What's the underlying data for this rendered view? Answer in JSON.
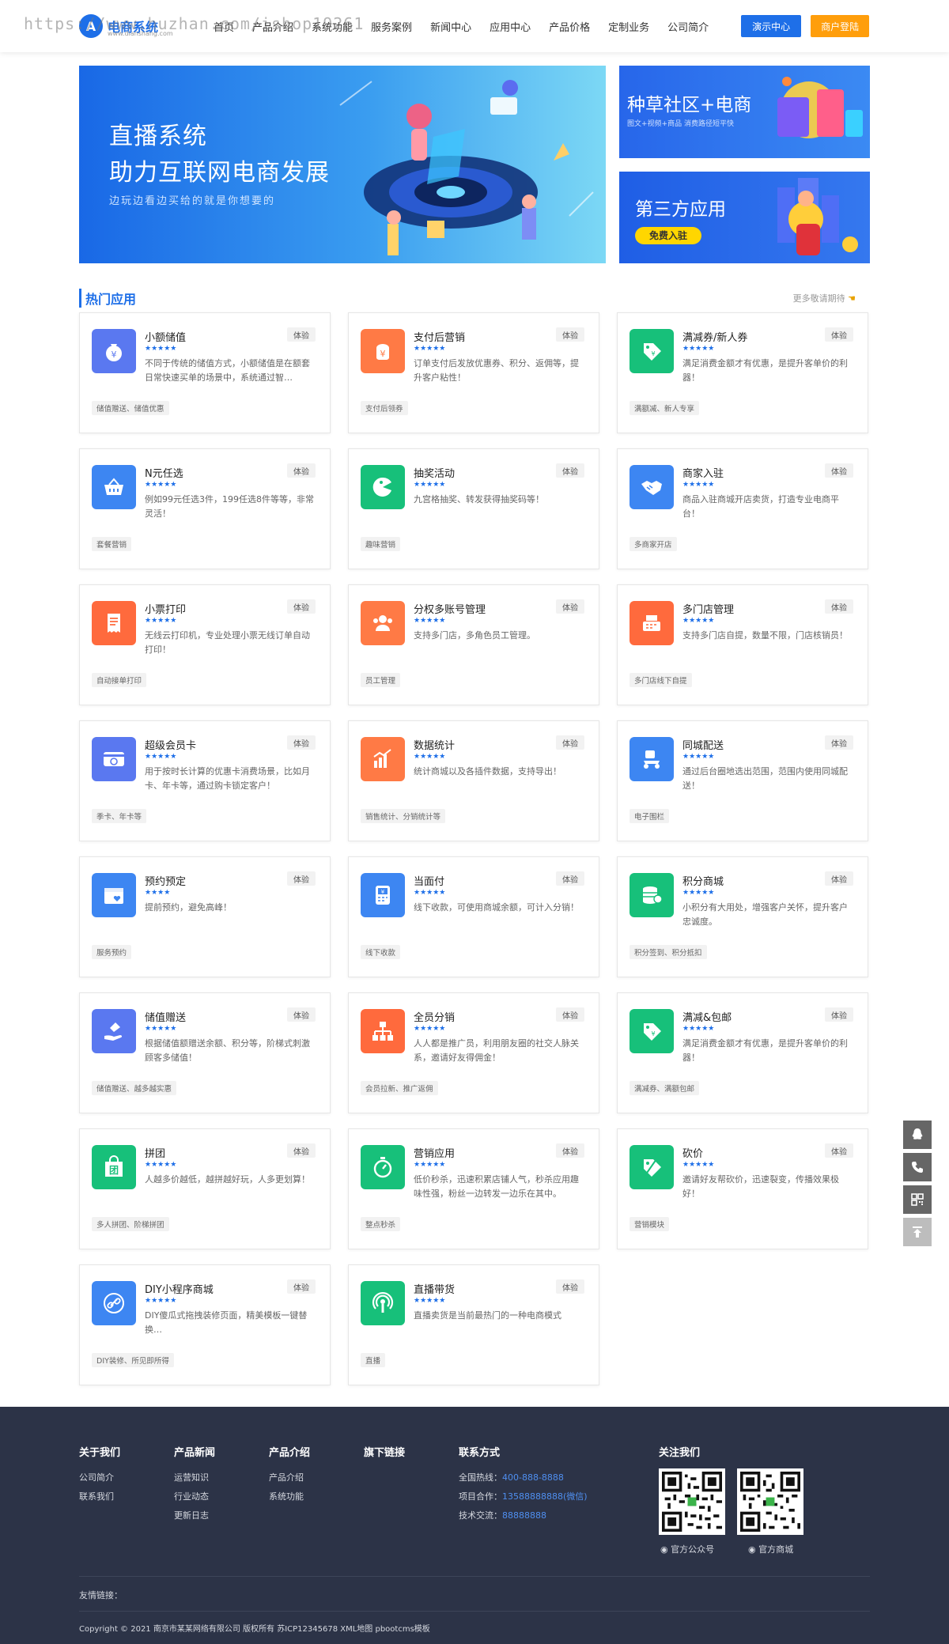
{
  "header": {
    "logo_text": "电商系统",
    "logo_sub": "www.dianshang.com",
    "watermark": "https://www.huzhan.com/ishop19261",
    "nav": [
      "首页",
      "产品介绍",
      "系统功能",
      "服务案例",
      "新闻中心",
      "应用中心",
      "产品价格",
      "定制业务",
      "公司简介"
    ],
    "demo_button": "演示中心",
    "login_button": "商户登陆"
  },
  "banners": {
    "main_line1": "直播系统",
    "main_line2": "助力互联网电商发展",
    "main_line3": "边玩边看边买给的就是你想要的",
    "side1_title": "种草社区+电商",
    "side1_sub": "图文+视频+商品 消费路径短平快",
    "side2_title": "第三方应用",
    "side2_button": "免费入驻"
  },
  "section": {
    "title": "热门应用",
    "more": "更多敬请期待"
  },
  "try_label": "体验",
  "apps": [
    {
      "title": "小额储值",
      "stars": "★★★★★",
      "desc": "不同于传统的储值方式，小额储值是在额套日常快速买单的场景中，系统通过智…",
      "tag": "储值赠送、储值优惠",
      "color": "#5a78f0",
      "icon": "money-bag-icon"
    },
    {
      "title": "支付后营销",
      "stars": "★★★★★",
      "desc": "订单支付后发放优惠券、积分、返佣等，提升客户粘性！",
      "tag": "支付后领券",
      "color": "#ff7a45",
      "icon": "yen-bag-icon"
    },
    {
      "title": "满减券/新人券",
      "stars": "★★★★★",
      "desc": "满足消费金额才有优惠，是提升客单价的利器！",
      "tag": "满额减、新人专享",
      "color": "#17c07a",
      "icon": "coupon-tag-icon"
    },
    {
      "title": "N元任选",
      "stars": "★★★★★",
      "desc": "例如99元任选3件，199任选8件等等，非常灵活！",
      "tag": "套餐营销",
      "color": "#3d86f2",
      "icon": "basket-icon"
    },
    {
      "title": "抽奖活动",
      "stars": "★★★★★",
      "desc": "九宫格抽奖、转发获得抽奖码等！",
      "tag": "趣味营销",
      "color": "#17c07a",
      "icon": "pacman-icon"
    },
    {
      "title": "商家入驻",
      "stars": "★★★★★",
      "desc": "商品入驻商城开店卖货，打造专业电商平台！",
      "tag": "多商家开店",
      "color": "#3d86f2",
      "icon": "handshake-icon"
    },
    {
      "title": "小票打印",
      "stars": "★★★★★",
      "desc": "无线云打印机，专业处理小票无线订单自动打印！",
      "tag": "自动接单打印",
      "color": "#ff6a3d",
      "icon": "receipt-icon"
    },
    {
      "title": "分权多账号管理",
      "stars": "★★★★★",
      "desc": "支持多门店，多角色员工管理。",
      "tag": "员工管理",
      "color": "#ff7a45",
      "icon": "users-icon"
    },
    {
      "title": "多门店管理",
      "stars": "★★★★★",
      "desc": "支持多门店自提，数量不限，门店核销员！",
      "tag": "多门店线下自提",
      "color": "#ff6a3d",
      "icon": "cash-register-icon"
    },
    {
      "title": "超级会员卡",
      "stars": "★★★★★",
      "desc": "用于按时长计算的优惠卡消费场景，比如月卡、年卡等，通过购卡锁定客户！",
      "tag": "季卡、年卡等",
      "color": "#5a78f0",
      "icon": "member-card-icon"
    },
    {
      "title": "数据统计",
      "stars": "★★★★★",
      "desc": "统计商城以及各插件数据，支持导出！",
      "tag": "销售统计、分销统计等",
      "color": "#ff7a45",
      "icon": "bar-chart-icon"
    },
    {
      "title": "同城配送",
      "stars": "★★★★★",
      "desc": "通过后台圈地选出范围，范围内使用同城配送！",
      "tag": "电子围栏",
      "color": "#3d86f2",
      "icon": "scooter-icon"
    },
    {
      "title": "预约预定",
      "stars": "★★★★",
      "desc": "提前预约，避免高峰！",
      "tag": "服务预约",
      "color": "#3d86f2",
      "icon": "calendar-heart-icon"
    },
    {
      "title": "当面付",
      "stars": "★★★★★",
      "desc": "线下收款，可使用商城余额，可计入分销！",
      "tag": "线下收款",
      "color": "#3d86f2",
      "icon": "payment-terminal-icon"
    },
    {
      "title": "积分商城",
      "stars": "★★★★★",
      "desc": "小积分有大用处，增强客户关怀，提升客户忠诚度。",
      "tag": "积分签到、积分抵扣",
      "color": "#17c07a",
      "icon": "coins-stack-icon"
    },
    {
      "title": "储值赠送",
      "stars": "★★★★★",
      "desc": "根据储值额赠送余额、积分等，阶梯式刺激顾客多储值！",
      "tag": "储值赠送、越多越实惠",
      "color": "#5a78f0",
      "icon": "hand-gift-icon"
    },
    {
      "title": "全员分销",
      "stars": "★★★★★",
      "desc": "人人都是推广员，利用朋友圈的社交人脉关系，邀请好友得佣金！",
      "tag": "会员拉新、推广返佣",
      "color": "#ff6a3d",
      "icon": "hierarchy-icon"
    },
    {
      "title": "满减&包邮",
      "stars": "★★★★★",
      "desc": "满足消费金额才有优惠，是提升客单价的利器！",
      "tag": "满减券、满额包邮",
      "color": "#17c07a",
      "icon": "coupon-tag-icon"
    },
    {
      "title": "拼团",
      "stars": "★★★★★",
      "desc": "人越多价越低，越拼越好玩，人多更划算！",
      "tag": "多人拼团、阶梯拼团",
      "color": "#17c07a",
      "icon": "shopping-bag-icon"
    },
    {
      "title": "营销应用",
      "stars": "★★★★★",
      "desc": "低价秒杀，迅速积累店铺人气，秒杀应用趣味性强，粉丝一边转发一边乐在其中。",
      "tag": "整点秒杀",
      "color": "#17c07a",
      "icon": "stopwatch-icon"
    },
    {
      "title": "砍价",
      "stars": "★★★★★",
      "desc": "邀请好友帮砍价，迅速裂变，传播效果极好！",
      "tag": "营销模块",
      "color": "#17c07a",
      "icon": "price-cut-icon"
    },
    {
      "title": "DIY小程序商城",
      "stars": "★★★★★",
      "desc": "DIY傻瓜式拖拽装修页面，精美模板一键替换…",
      "tag": "DIY装修、所见即所得",
      "color": "#3d86f2",
      "icon": "link-icon"
    },
    {
      "title": "直播带货",
      "stars": "★★★★★",
      "desc": "直播卖货是当前最热门的一种电商模式",
      "tag": "直播",
      "color": "#17c07a",
      "icon": "broadcast-icon"
    }
  ],
  "footer": {
    "about": {
      "title": "关于我们",
      "links": [
        "公司简介",
        "联系我们"
      ]
    },
    "news": {
      "title": "产品新闻",
      "links": [
        "运营知识",
        "行业动态",
        "更新日志"
      ]
    },
    "product": {
      "title": "产品介绍",
      "links": [
        "产品介绍",
        "系统功能"
      ]
    },
    "flagship": {
      "title": "旗下链接"
    },
    "contact": {
      "title": "联系方式",
      "hotline_label": "全国热线：",
      "hotline": "400-888-8888",
      "coop_label": "项目合作：",
      "coop": "13588888888(微信)",
      "tech_label": "技术交流：",
      "tech": "88888888"
    },
    "follow": {
      "title": "关注我们",
      "qr1_label": "官方公众号",
      "qr2_label": "官方商城"
    },
    "friend_links": "友情链接：",
    "copyright": "Copyright © 2021 南京市某某网络有限公司 版权所有 苏ICP12345678 XML地图 pbootcms模板"
  },
  "float": [
    "qq-icon",
    "phone-icon",
    "qrcode-icon",
    "back-to-top-icon"
  ]
}
